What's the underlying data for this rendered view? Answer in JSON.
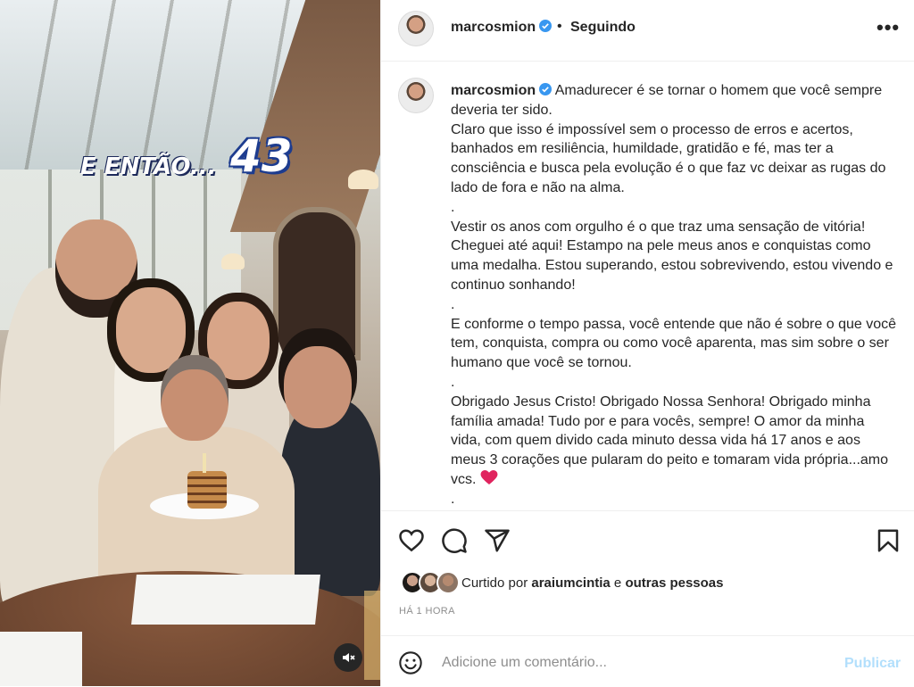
{
  "media": {
    "overlay_text": "E ENTÃO...",
    "overlay_number": "43"
  },
  "post": {
    "username": "marcosmion",
    "follow_status": "Seguindo",
    "separator": "•",
    "more_icon": "more-options-icon",
    "verified_color": "#3897f0",
    "caption": "Amadurecer é se tornar o homem que você sempre deveria ter sido.\nClaro que isso é impossível sem o processo de erros e acertos, banhados em resiliência, humildade, gratidão e fé, mas ter a consciência e busca pela evolução é o que faz vc deixar as rugas do lado de fora e não na alma.\n.\nVestir os anos com orgulho é o que traz uma sensação de vitória! Cheguei até aqui! Estampo na pele meus anos e conquistas como uma medalha. Estou superando, estou sobrevivendo, estou vivendo e continuo sonhando!\n.\nE conforme o tempo passa, você entende que não é sobre o que você tem, conquista, compra ou como você aparenta, mas sim sobre o ser humano que você se tornou.\n.\nObrigado Jesus Cristo! Obrigado Nossa Senhora! Obrigado minha família amada! Tudo por e para vocês, sempre! O amor da minha vida, com quem divido cada minuto dessa vida há 17 anos e aos meus 3 corações que pularam do peito e tomaram vida própria...amo vcs. ",
    "caption_end": "\n."
  },
  "likes": {
    "prefix": "Curtido por",
    "user": "araiumcintia",
    "conj": "e",
    "others": "outras pessoas"
  },
  "timestamp": "HÁ 1 HORA",
  "comment": {
    "placeholder": "Adicione um comentário...",
    "publish_label": "Publicar",
    "publish_color": "#b2dffc"
  },
  "icons": [
    "heart-icon",
    "comment-icon",
    "share-icon",
    "bookmark-icon",
    "emoji-icon",
    "mute-icon"
  ]
}
